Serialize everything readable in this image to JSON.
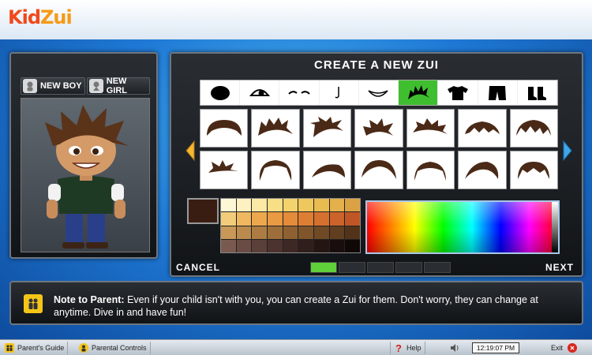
{
  "app": {
    "logo_text_1": "Kid",
    "logo_text_2": "Zui"
  },
  "left_panel": {
    "new_boy_label": "NEW BOY",
    "new_girl_label": "NEW GIRL"
  },
  "editor": {
    "title": "CREATE A NEW ZUI",
    "categories": [
      {
        "icon": "head-shape-icon"
      },
      {
        "icon": "eye-icon"
      },
      {
        "icon": "eyebrow-icon"
      },
      {
        "icon": "nose-icon"
      },
      {
        "icon": "mouth-icon"
      },
      {
        "icon": "hair-icon",
        "active": true
      },
      {
        "icon": "shirt-icon"
      },
      {
        "icon": "pants-icon"
      },
      {
        "icon": "shoes-icon"
      }
    ],
    "hair_options_count": 14,
    "selected_color": "#3a1d12",
    "swatches": [
      "#fef7d6",
      "#fdf1c2",
      "#fbe9a6",
      "#f8df86",
      "#f3d36d",
      "#efc85d",
      "#e9bc51",
      "#e4b049",
      "#dba244",
      "#f2cc7a",
      "#f0b860",
      "#eda84e",
      "#e99a42",
      "#e48c3a",
      "#de7e34",
      "#d6702f",
      "#cc632a",
      "#c05626",
      "#c89858",
      "#bb8a4d",
      "#ad7c43",
      "#9e6e3a",
      "#8f6132",
      "#80552b",
      "#704925",
      "#613e1f",
      "#52331a",
      "#7a5a50",
      "#6a4c44",
      "#5b3f39",
      "#4c332f",
      "#3e2825",
      "#301e1c",
      "#241513",
      "#190e0d",
      "#0f0807"
    ],
    "cancel_label": "CANCEL",
    "next_label": "NEXT",
    "progress_steps": 5,
    "progress_current": 1
  },
  "note": {
    "heading": "Note to Parent:",
    "body": " Even if your child isn't with you, you can create a Zui for them.  Don't worry, they can change at anytime. Dive in and have fun!"
  },
  "taskbar": {
    "parents_guide": "Parent's Guide",
    "parental_controls": "Parental Controls",
    "help": "Help",
    "clock": "12:19:07 PM",
    "exit": "Exit"
  }
}
